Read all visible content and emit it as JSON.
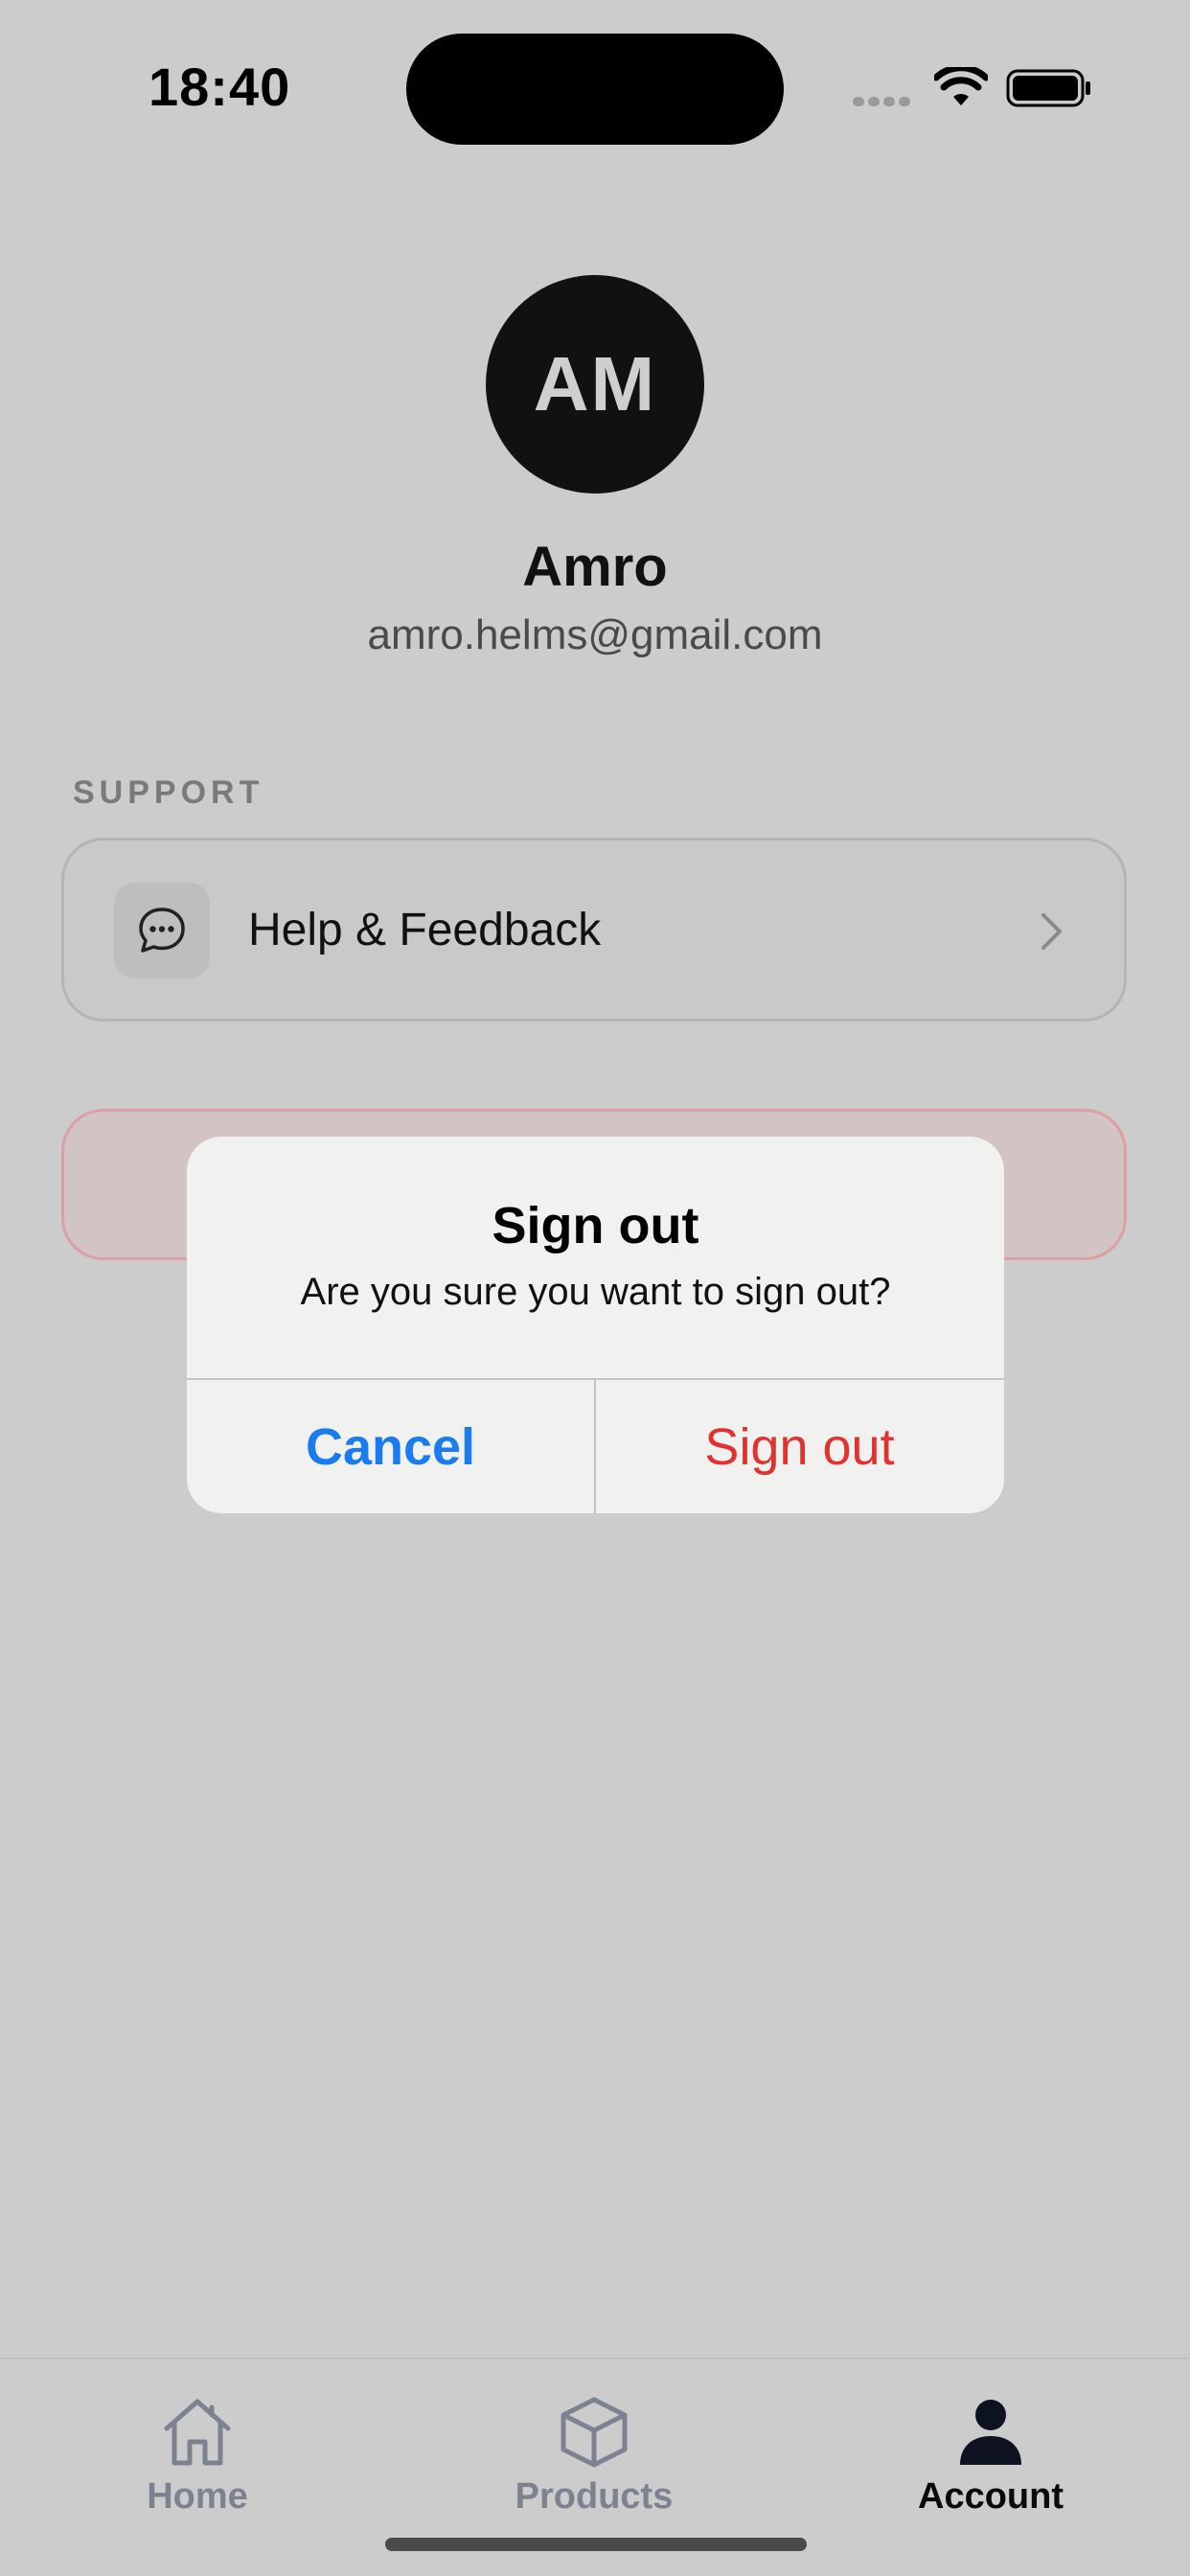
{
  "status_bar": {
    "time": "18:40",
    "icons": [
      "signal-icon",
      "wifi-icon",
      "battery-icon"
    ]
  },
  "profile": {
    "initials": "AM",
    "name": "Amro",
    "email": "amro.helms@gmail.com"
  },
  "support": {
    "section_label": "SUPPORT",
    "items": [
      {
        "label": "Help & Feedback",
        "icon": "chat-bubble-icon"
      }
    ]
  },
  "dialog": {
    "title": "Sign out",
    "message": "Are you sure you want to sign out?",
    "cancel_label": "Cancel",
    "confirm_label": "Sign out"
  },
  "tabbar": {
    "tabs": [
      {
        "label": "Home",
        "icon": "home-icon",
        "active": false
      },
      {
        "label": "Products",
        "icon": "box-icon",
        "active": false
      },
      {
        "label": "Account",
        "icon": "person-icon",
        "active": true
      }
    ]
  },
  "colors": {
    "background": "#cccccc",
    "accent_blue": "#1a7cf0",
    "destructive_red": "#e2322f"
  }
}
